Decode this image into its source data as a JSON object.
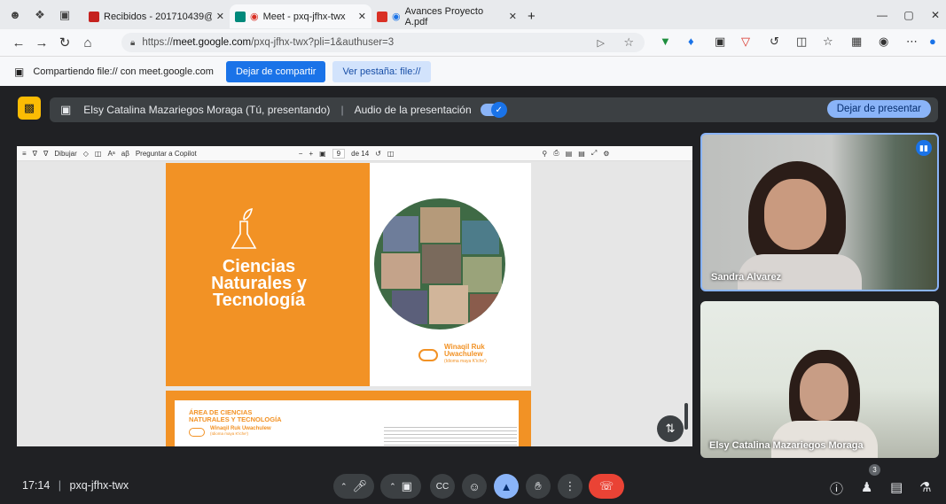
{
  "browser": {
    "tabs": [
      {
        "title": "Recibidos - 201710439@farusac.e",
        "favicon_color": "#c5221f"
      },
      {
        "title": "Meet - pxq-jfhx-twx",
        "favicon_color": "#00897b"
      },
      {
        "title": "Avances Proyecto A.pdf",
        "favicon_color": "#d93025"
      }
    ],
    "new_tab": "+",
    "url_prefix": "https://",
    "url_host": "meet.google.com",
    "url_path": "/pxq-jfhx-twx?pli=1&authuser=3"
  },
  "share_bar": {
    "text": "Compartiendo file:// con meet.google.com",
    "stop_button": "Dejar de compartir",
    "view_button": "Ver pestaña: file://"
  },
  "presentation_bar": {
    "presenter": "Elsy Catalina Mazariegos Moraga (Tú, presentando)",
    "audio_label": "Audio de la presentación",
    "audio_on": true,
    "stop_button": "Dejar de presentar"
  },
  "pdf_viewer": {
    "draw_label": "Dibujar",
    "copilot_label": "Preguntar a Copilot",
    "page_current": "9",
    "page_total": "de 14",
    "cover": {
      "title_line1": "Ciencias",
      "title_line2": "Naturales y",
      "title_line3": "Tecnología",
      "brand_line1": "Winaqil Ruk",
      "brand_line2": "Uwachulew",
      "brand_sub": "(Idioma maya K'iche')"
    },
    "page2": {
      "heading_line1": "ÁREA DE CIENCIAS",
      "heading_line2": "NATURALES Y TECNOLOGÍA",
      "brand": "Winaqil Ruk Uwachulew",
      "brand_sub": "(Idioma maya K'iche')"
    }
  },
  "participants": [
    {
      "name": "Sandra Alvarez",
      "speaking": true
    },
    {
      "name": "Elsy Catalina Mazariegos Moraga",
      "speaking": false
    }
  ],
  "controls": {
    "time": "17:14",
    "meeting_code": "pxq-jfhx-twx",
    "people_count": "3"
  }
}
